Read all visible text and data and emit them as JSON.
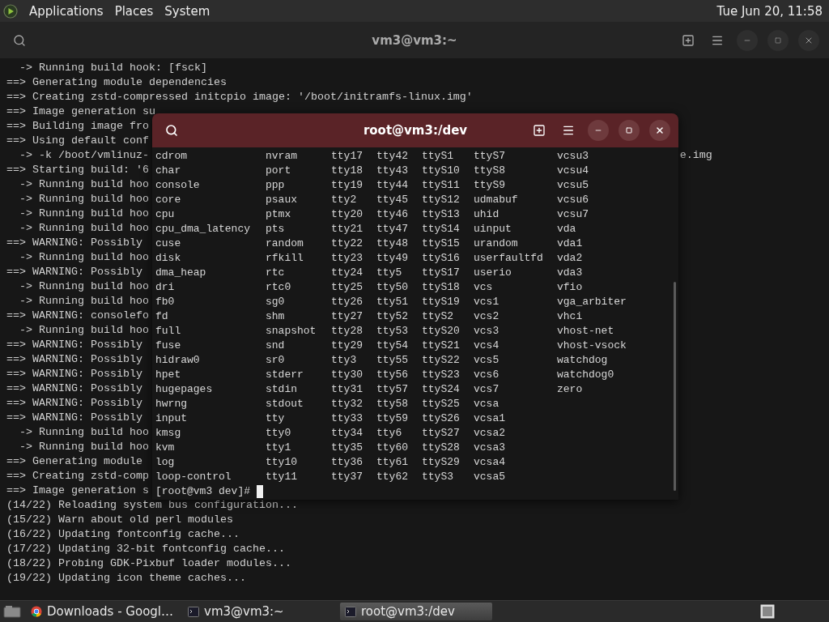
{
  "top_panel": {
    "menus": [
      "Applications",
      "Places",
      "System"
    ],
    "clock": "Tue Jun 20, 11:58"
  },
  "back_terminal": {
    "title": "vm3@vm3:~",
    "lines": [
      {
        "text": "  -> Running build hook: [fsck]"
      },
      {
        "text": "==> Generating module dependencies"
      },
      {
        "text": "==> Creating zstd-compressed initcpio image: '/boot/initramfs-linux.img'"
      },
      {
        "text": "==> Image generation su"
      },
      {
        "text": "==> Building image fro"
      },
      {
        "text": "==> Using default conf"
      },
      {
        "text": "  -> -k /boot/vmlinuz-",
        "tail": "e.img"
      },
      {
        "text": "==> Starting build: '6"
      },
      {
        "text": "  -> Running build hoo"
      },
      {
        "text": "  -> Running build hoo"
      },
      {
        "text": "  -> Running build hoo"
      },
      {
        "text": "  -> Running build hoo"
      },
      {
        "text": "==> WARNING: Possibly"
      },
      {
        "text": "  -> Running build hoo"
      },
      {
        "text": "==> WARNING: Possibly"
      },
      {
        "text": "  -> Running build hoo"
      },
      {
        "text": "  -> Running build hoo"
      },
      {
        "text": "==> WARNING: consolefo"
      },
      {
        "text": "  -> Running build hoo"
      },
      {
        "text": "==> WARNING: Possibly"
      },
      {
        "text": "==> WARNING: Possibly"
      },
      {
        "text": "==> WARNING: Possibly"
      },
      {
        "text": "==> WARNING: Possibly"
      },
      {
        "text": "==> WARNING: Possibly"
      },
      {
        "text": "==> WARNING: Possibly"
      },
      {
        "text": "  -> Running build hoo"
      },
      {
        "text": "  -> Running build hoo"
      },
      {
        "text": "==> Generating module"
      },
      {
        "text": "==> Creating zstd-comp"
      },
      {
        "text": "==> Image generation s"
      },
      {
        "text": "(14/22) Reloading system bus configuration..."
      },
      {
        "text": "(15/22) Warn about old perl modules"
      },
      {
        "text": "(16/22) Updating fontconfig cache..."
      },
      {
        "text": "(17/22) Updating 32-bit fontconfig cache..."
      },
      {
        "text": "(18/22) Probing GDK-Pixbuf loader modules..."
      },
      {
        "text": "(19/22) Updating icon theme caches..."
      }
    ]
  },
  "front_terminal": {
    "title": "root@vm3:/dev",
    "listing_columns": [
      [
        "cdrom",
        "char",
        "console",
        "core",
        "cpu",
        "cpu_dma_latency",
        "cuse",
        "disk",
        "dma_heap",
        "dri",
        "fb0",
        "fd",
        "full",
        "fuse",
        "hidraw0",
        "hpet",
        "hugepages",
        "hwrng",
        "input",
        "kmsg",
        "kvm",
        "log",
        "loop-control"
      ],
      [
        "nvram",
        "port",
        "ppp",
        "psaux",
        "ptmx",
        "pts",
        "random",
        "rfkill",
        "rtc",
        "rtc0",
        "sg0",
        "shm",
        "snapshot",
        "snd",
        "sr0",
        "stderr",
        "stdin",
        "stdout",
        "tty",
        "tty0",
        "tty1",
        "tty10",
        "tty11"
      ],
      [
        "tty17",
        "tty18",
        "tty19",
        "tty2",
        "tty20",
        "tty21",
        "tty22",
        "tty23",
        "tty24",
        "tty25",
        "tty26",
        "tty27",
        "tty28",
        "tty29",
        "tty3",
        "tty30",
        "tty31",
        "tty32",
        "tty33",
        "tty34",
        "tty35",
        "tty36",
        "tty37"
      ],
      [
        "tty42",
        "tty43",
        "tty44",
        "tty45",
        "tty46",
        "tty47",
        "tty48",
        "tty49",
        "tty5",
        "tty50",
        "tty51",
        "tty52",
        "tty53",
        "tty54",
        "tty55",
        "tty56",
        "tty57",
        "tty58",
        "tty59",
        "tty6",
        "tty60",
        "tty61",
        "tty62"
      ],
      [
        "ttyS1",
        "ttyS10",
        "ttyS11",
        "ttyS12",
        "ttyS13",
        "ttyS14",
        "ttyS15",
        "ttyS16",
        "ttyS17",
        "ttyS18",
        "ttyS19",
        "ttyS2",
        "ttyS20",
        "ttyS21",
        "ttyS22",
        "ttyS23",
        "ttyS24",
        "ttyS25",
        "ttyS26",
        "ttyS27",
        "ttyS28",
        "ttyS29",
        "ttyS3"
      ],
      [
        "ttyS7",
        "ttyS8",
        "ttyS9",
        "udmabuf",
        "uhid",
        "uinput",
        "urandom",
        "userfaultfd",
        "userio",
        "vcs",
        "vcs1",
        "vcs2",
        "vcs3",
        "vcs4",
        "vcs5",
        "vcs6",
        "vcs7",
        "vcsa",
        "vcsa1",
        "vcsa2",
        "vcsa3",
        "vcsa4",
        "vcsa5"
      ],
      [
        "vcsu3",
        "vcsu4",
        "vcsu5",
        "vcsu6",
        "vcsu7",
        "vda",
        "vda1",
        "vda2",
        "vda3",
        "vfio",
        "vga_arbiter",
        "vhci",
        "vhost-net",
        "vhost-vsock",
        "watchdog",
        "watchdog0",
        "zero"
      ]
    ],
    "prompt": "[root@vm3 dev]#"
  },
  "taskbar": {
    "items": [
      {
        "label": "Downloads - Googl…",
        "kind": "browser",
        "selected": false
      },
      {
        "label": "vm3@vm3:~",
        "kind": "terminal",
        "selected": false
      },
      {
        "label": "root@vm3:/dev",
        "kind": "terminal",
        "selected": true
      }
    ]
  }
}
